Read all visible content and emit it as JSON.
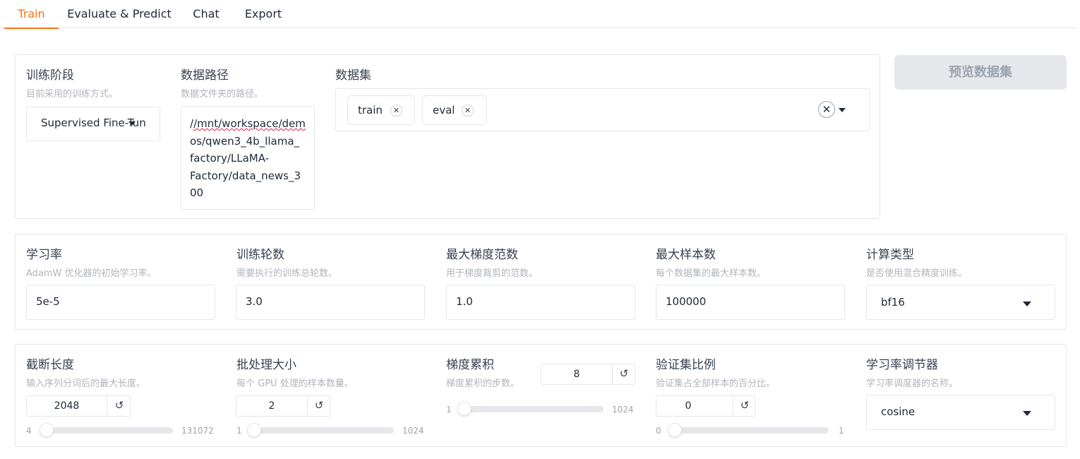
{
  "tabs": [
    "Train",
    "Evaluate & Predict",
    "Chat",
    "Export"
  ],
  "active_tab": "Train",
  "accent_color": "#f97316",
  "row1": {
    "stage": {
      "label": "训练阶段",
      "info": "目前采用的训练方式。",
      "value": "Supervised Fine-Tuning"
    },
    "data_path": {
      "label": "数据路径",
      "info": "数据文件夹的路径。",
      "lines": [
        "/mnt/workspace/dem",
        "os/qwen3_4b_llama_",
        "factory/LLaMA-",
        "Factory/data_news_3",
        "00"
      ]
    },
    "dataset": {
      "label": "数据集",
      "chips": [
        "train",
        "eval"
      ],
      "chip_remove_icon": "close-icon",
      "clear_icon": "clear-all-icon"
    },
    "preview_button": "预览数据集"
  },
  "row2": {
    "learning_rate": {
      "label": "学习率",
      "info": "AdamW 优化器的初始学习率。",
      "value": "5e-5"
    },
    "epochs": {
      "label": "训练轮数",
      "info": "需要执行的训练总轮数。",
      "value": "3.0"
    },
    "max_grad_norm": {
      "label": "最大梯度范数",
      "info": "用于梯度裁剪的范数。",
      "value": "1.0"
    },
    "max_samples": {
      "label": "最大样本数",
      "info": "每个数据集的最大样本数。",
      "value": "100000"
    },
    "compute_type": {
      "label": "计算类型",
      "info": "是否使用混合精度训练。",
      "value": "bf16"
    }
  },
  "row3": {
    "cutoff_len": {
      "label": "截断长度",
      "info": "输入序列分词后的最大长度。",
      "value": "2048",
      "min": "4",
      "max": "131072",
      "fraction": 0.0156
    },
    "batch_size": {
      "label": "批处理大小",
      "info": "每个 GPU 处理的样本数量。",
      "value": "2",
      "min": "1",
      "max": "1024",
      "fraction": 0.001
    },
    "grad_accum": {
      "label": "梯度累积",
      "info": "梯度累积的步数。",
      "value": "8",
      "min": "1",
      "max": "1024",
      "fraction": 0.0068
    },
    "val_size": {
      "label": "验证集比例",
      "info": "验证集占全部样本的百分比。",
      "value": "0",
      "min": "0",
      "max": "1",
      "fraction": 0
    },
    "lr_scheduler": {
      "label": "学习率调节器",
      "info": "学习率调度器的名称。",
      "value": "cosine"
    }
  },
  "reset_icon": "↺"
}
